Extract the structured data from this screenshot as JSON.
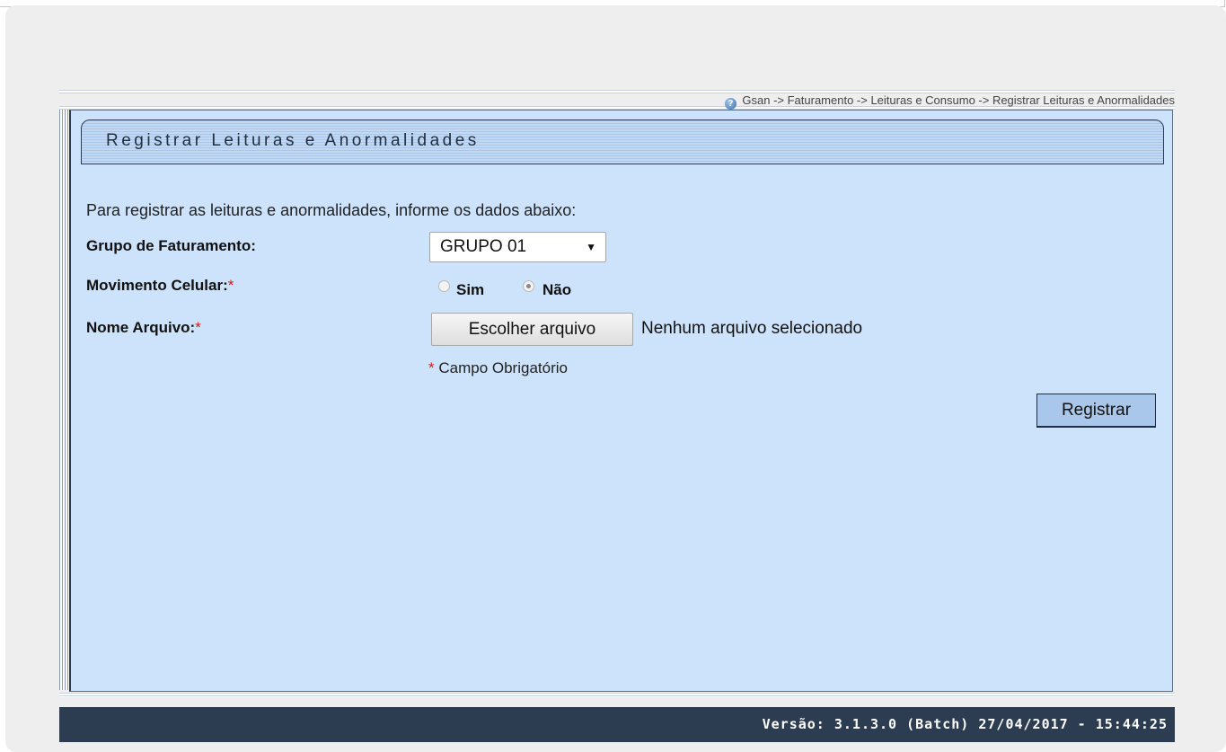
{
  "breadcrumb": "Gsan -> Faturamento -> Leituras e Consumo -> Registrar Leituras e Anormalidades",
  "page_title": "Registrar Leituras e Anormalidades",
  "intro": "Para registrar as leituras e anormalidades, informe os dados abaixo:",
  "fields": {
    "grupo_label": "Grupo de Faturamento:",
    "grupo_value": "GRUPO 01",
    "movimento_label": "Movimento Celular:",
    "movimento_options": {
      "sim": "Sim",
      "nao": "Não"
    },
    "movimento_selected": "Não",
    "arquivo_label": "Nome Arquivo:",
    "arquivo_button": "Escolher arquivo",
    "arquivo_status": "Nenhum arquivo selecionado",
    "required_star": "*",
    "required_note": "Campo Obrigatório"
  },
  "actions": {
    "register": "Registrar"
  },
  "footer": "Versão: 3.1.3.0 (Batch) 27/04/2017 - 15:44:25",
  "colors": {
    "panel": "#cde2fb",
    "footer": "#2c3d52",
    "required": "#d31b1b"
  },
  "icons": {
    "help": "help-icon",
    "dropdown": "chevron-down-icon"
  }
}
